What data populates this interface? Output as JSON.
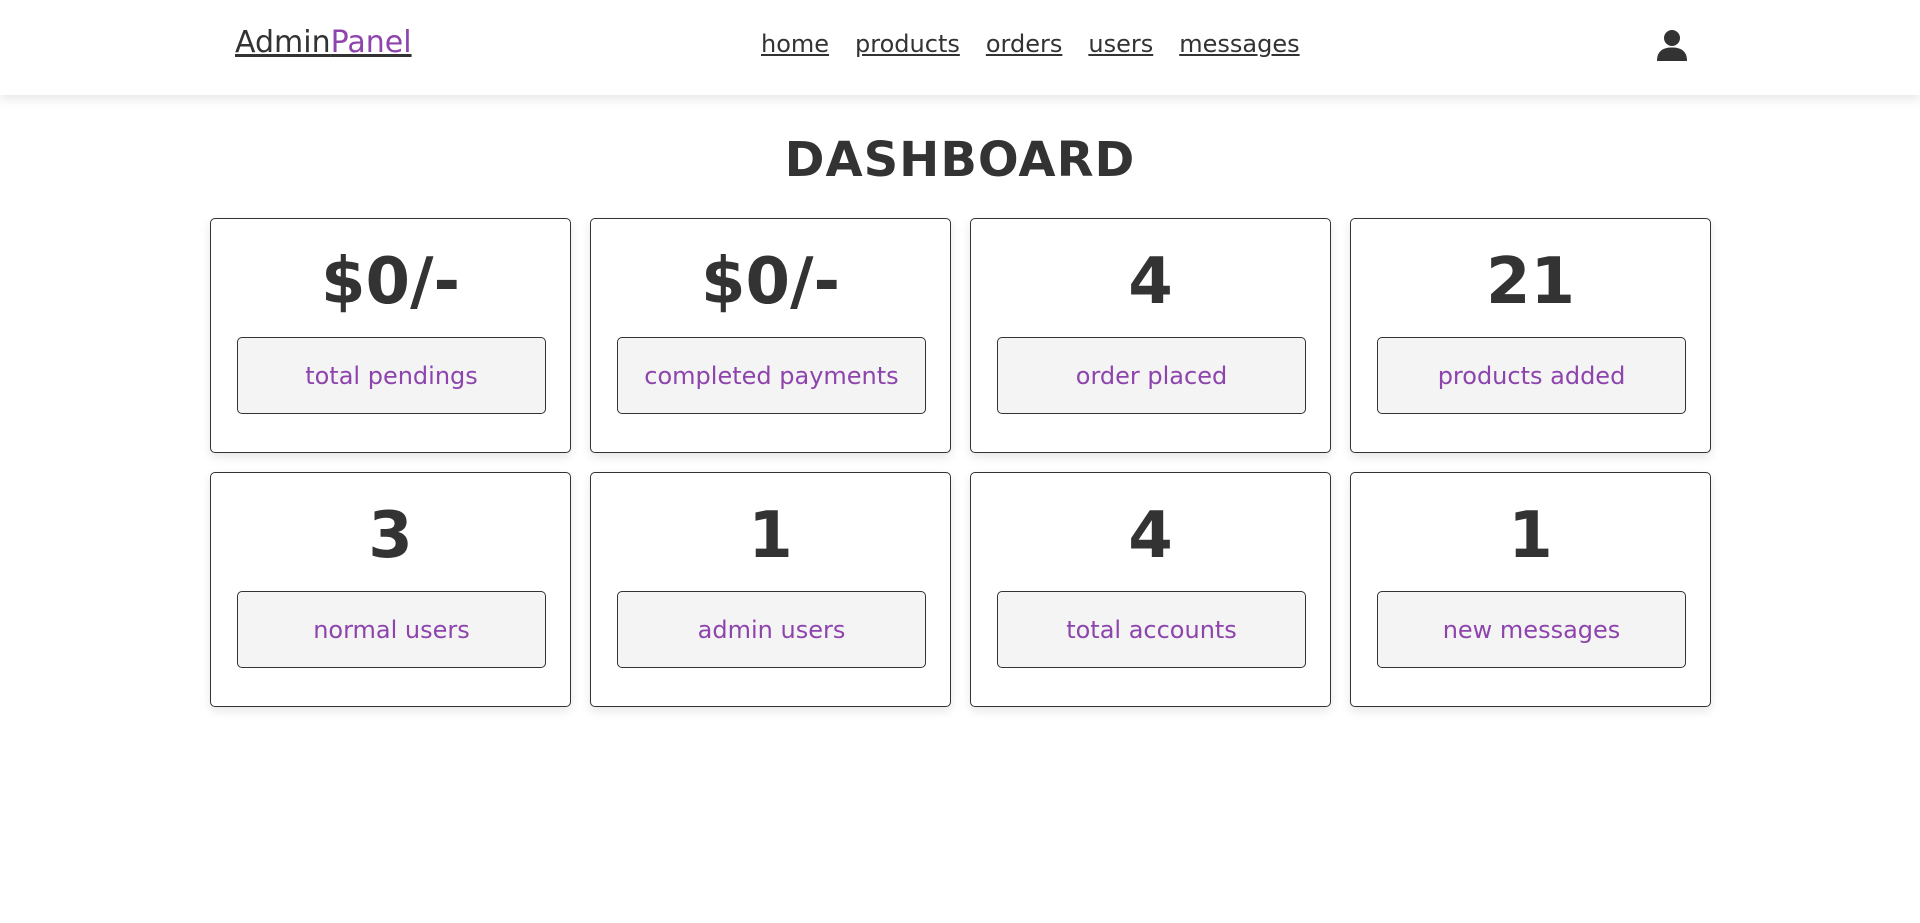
{
  "header": {
    "logo": {
      "part1": "Admin",
      "part2": "Panel"
    },
    "nav": [
      "home",
      "products",
      "orders",
      "users",
      "messages"
    ],
    "user_icon": "user-icon"
  },
  "main": {
    "title": "DASHBOARD",
    "cards": [
      {
        "value": "$0/-",
        "label": "total pendings"
      },
      {
        "value": "$0/-",
        "label": "completed payments"
      },
      {
        "value": "4",
        "label": "order placed"
      },
      {
        "value": "21",
        "label": "products added"
      },
      {
        "value": "3",
        "label": "normal users"
      },
      {
        "value": "1",
        "label": "admin users"
      },
      {
        "value": "4",
        "label": "total accounts"
      },
      {
        "value": "1",
        "label": "new messages"
      }
    ]
  },
  "colors": {
    "accent": "#8e44ad",
    "text": "#333333",
    "button_bg": "#f4f4f4"
  }
}
